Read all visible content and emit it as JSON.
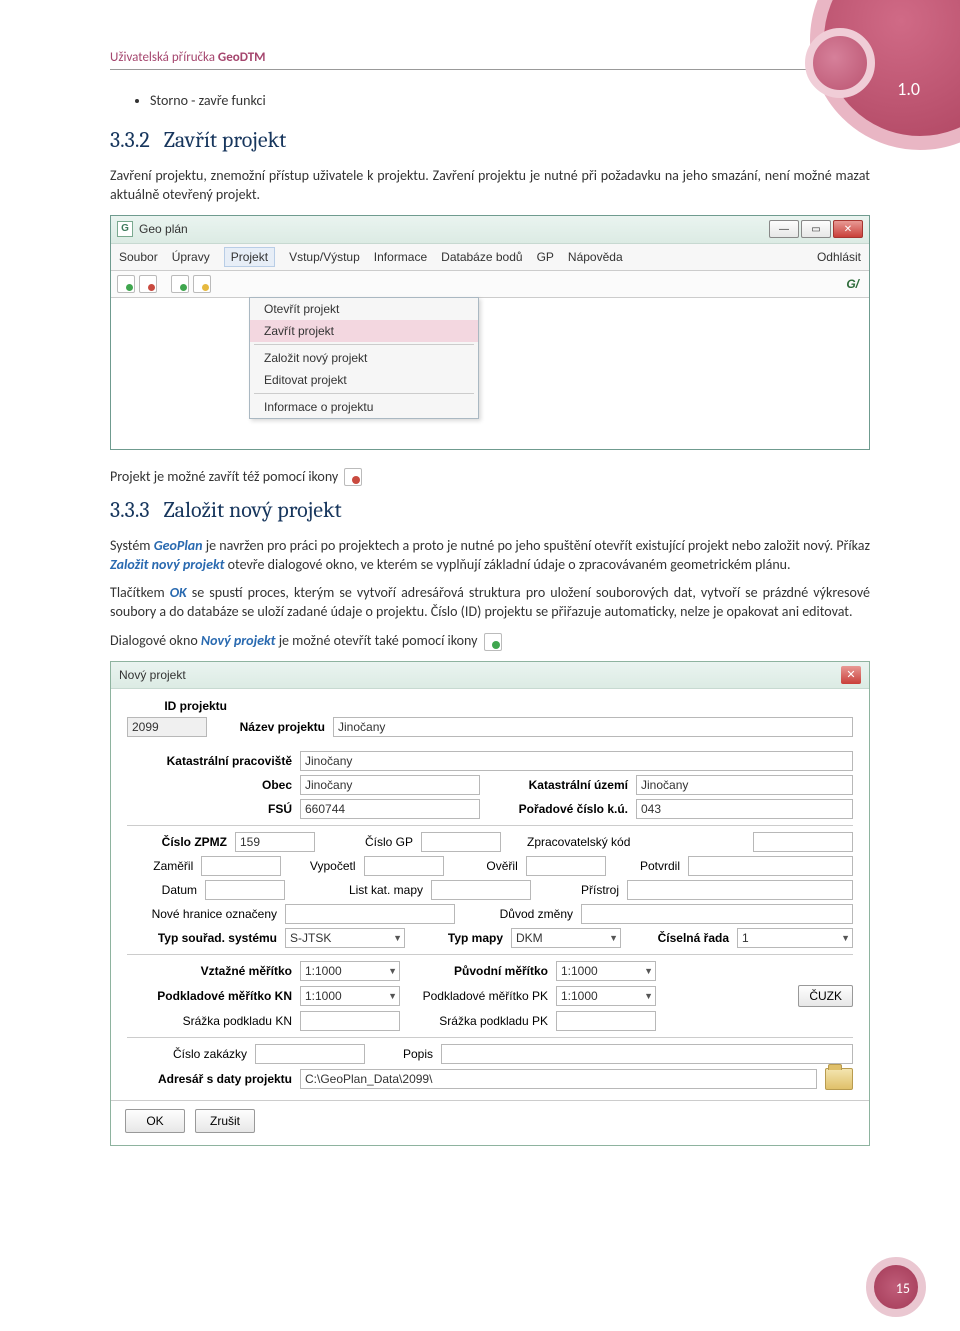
{
  "header": {
    "prefix": "Uživatelská příručka ",
    "product": "GeoDTM"
  },
  "version": "1.0",
  "bullet1": "Storno - zavře funkci",
  "sec32": {
    "num": "3.3.2",
    "title": "Zavřít projekt",
    "p1": "Zavření projektu, znemožní přístup uživatele k projektu. Zavření projektu je nutné při požadavku na jeho smazání, není možné mazat aktuálně otevřený projekt."
  },
  "ss1": {
    "windowTitle": "Geo plán",
    "menubar": [
      "Soubor",
      "Úpravy",
      "Projekt",
      "Vstup/Výstup",
      "Informace",
      "Databáze bodů",
      "GP",
      "Nápověda"
    ],
    "logout": "Odhlásit",
    "gp": "G/",
    "dropdown": {
      "i1": "Otevřít projekt",
      "i2": "Zavřít projekt",
      "i3": "Založit nový projekt",
      "i4": "Editovat projekt",
      "i5": "Informace o projektu"
    }
  },
  "afterSs1": "Projekt je možné zavřít též pomocí ikony",
  "sec33": {
    "num": "3.3.3",
    "title": "Založit nový projekt",
    "p1a": "Systém ",
    "p1_geo": "GeoPlan",
    "p1b": " je navržen pro práci po projektech a proto je nutné po jeho spuštění otevřít existující projekt nebo založit nový. Příkaz ",
    "p1_cmd": "Založit nový projekt",
    "p1c": " otevře dialogové okno, ve kterém se vyplňují základní údaje o zpracovávaném geometrickém plánu.",
    "p2a": "Tlačítkem ",
    "p2_ok": "OK",
    "p2b": " se spustí proces, kterým se vytvoří adresářová struktura pro uložení souborových dat, vytvoří se prázdné výkresové soubory a do databáze se uloží zadané údaje o projektu. Číslo (ID) projektu se přiřazuje automaticky, nelze je opakovat ani editovat.",
    "p3a": "Dialogové okno ",
    "p3_np": "Nový projekt",
    "p3b": " je možné otevřít také pomocí ikony"
  },
  "ss2": {
    "title": "Nový projekt",
    "labels": {
      "id": "ID projektu",
      "nazev": "Název projektu",
      "kp": "Katastrální pracoviště",
      "obec": "Obec",
      "ku": "Katastrální území",
      "fsu": "FSÚ",
      "porc": "Pořadové číslo k.ú.",
      "zpmz": "Číslo ZPMZ",
      "gp": "Číslo GP",
      "zprkod": "Zpracovatelský kód",
      "zameril": "Zaměřil",
      "vypocetl": "Vypočetl",
      "overil": "Ověřil",
      "potvrdil": "Potvrdil",
      "datum": "Datum",
      "listmap": "List kat. mapy",
      "pristroj": "Přístroj",
      "hranice": "Nové hranice označeny",
      "duvod": "Důvod změny",
      "typsour": "Typ souřad. systému",
      "typmapy": "Typ mapy",
      "ciselna": "Číselná řada",
      "vztmer": "Vztažné měřítko",
      "puvmer": "Původní měřítko",
      "podkn": "Podkladové měřítko KN",
      "podpk": "Podkladové měřítko PK",
      "srazkn": "Srážka podkladu KN",
      "srazpk": "Srážka podkladu PK",
      "zakazka": "Číslo zakázky",
      "popis": "Popis",
      "adresar": "Adresář s daty projektu",
      "cuzk": "ČUZK"
    },
    "values": {
      "id": "2099",
      "nazev": "Jinočany",
      "kp": "Jinočany",
      "obec": "Jinočany",
      "ku": "Jinočany",
      "fsu": "660744",
      "porc": "043",
      "zpmz": "159",
      "typsour": "S-JTSK",
      "typmapy": "DKM",
      "ciselna": "1",
      "vztmer": "1:1000",
      "puvmer": "1:1000",
      "podkn": "1:1000",
      "podpk": "1:1000",
      "adresar": "C:\\GeoPlan_Data\\2099\\"
    },
    "buttons": {
      "ok": "OK",
      "cancel": "Zrušit"
    }
  },
  "pageNumber": "15"
}
